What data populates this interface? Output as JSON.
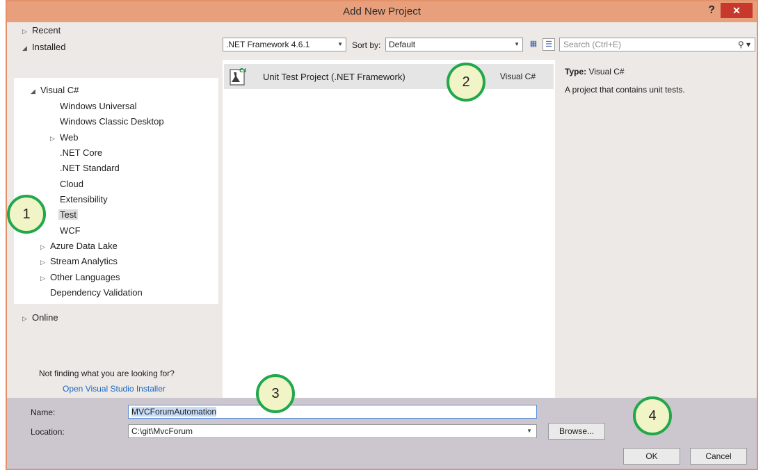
{
  "window": {
    "title": "Add New Project",
    "help": "?",
    "close": "✕"
  },
  "left": {
    "recent": "Recent",
    "installed": "Installed",
    "tree": [
      {
        "label": "Visual C#",
        "prefix": "◢"
      },
      {
        "label": "Windows Universal"
      },
      {
        "label": "Windows Classic Desktop"
      },
      {
        "label": "Web",
        "prefix": "▷"
      },
      {
        "label": ".NET Core"
      },
      {
        "label": ".NET Standard"
      },
      {
        "label": "Cloud"
      },
      {
        "label": "Extensibility"
      },
      {
        "label": "Test",
        "selected": true
      },
      {
        "label": "WCF"
      },
      {
        "label": "Azure Data Lake",
        "prefix": "▷"
      },
      {
        "label": "Stream Analytics",
        "prefix": "▷"
      },
      {
        "label": "Other Languages",
        "prefix": "▷"
      },
      {
        "label": "Dependency Validation"
      }
    ],
    "online": "Online",
    "not_finding": "Not finding what you are looking for?",
    "installer_link": "Open Visual Studio Installer"
  },
  "toolbar": {
    "framework": ".NET Framework 4.6.1",
    "sort_label": "Sort by:",
    "sort_value": "Default",
    "search_placeholder": "Search (Ctrl+E)"
  },
  "project": {
    "name": "Unit Test Project (.NET Framework)",
    "language": "Visual C#"
  },
  "details": {
    "type_label": "Type:",
    "type_value": "Visual C#",
    "description": "A project that contains unit tests."
  },
  "form": {
    "name_label": "Name:",
    "name_value": "MVCForumAutomation",
    "location_label": "Location:",
    "location_value": "C:\\git\\MvcForum",
    "browse": "Browse...",
    "ok": "OK",
    "cancel": "Cancel"
  },
  "callouts": [
    "1",
    "2",
    "3",
    "4"
  ],
  "colors": {
    "titlebar": "#e8a07c",
    "close": "#c7392d",
    "callout_ring": "#20a84a",
    "callout_fill": "#f0f4c6",
    "link": "#1b68c4"
  }
}
